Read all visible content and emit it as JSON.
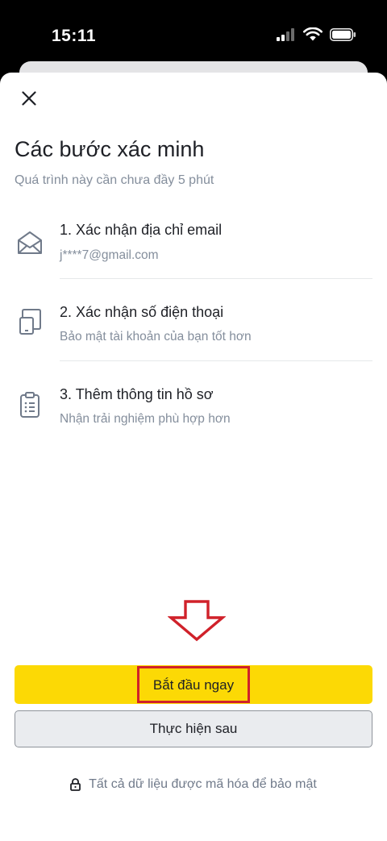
{
  "status_bar": {
    "time": "15:11",
    "icons": [
      "cellular-signal-icon",
      "wifi-icon",
      "battery-icon"
    ]
  },
  "header": {
    "close_icon": "close-icon",
    "title": "Các bước xác minh",
    "subtitle": "Quá trình này cần chưa đầy 5 phút"
  },
  "steps": [
    {
      "icon": "envelope-icon",
      "title": "1. Xác nhận địa chỉ email",
      "subtitle": "j****7@gmail.com"
    },
    {
      "icon": "phone-icon",
      "title": "2. Xác nhận số điện thoại",
      "subtitle": "Bảo mật tài khoản của bạn tốt hơn"
    },
    {
      "icon": "clipboard-icon",
      "title": "3. Thêm thông tin hồ sơ",
      "subtitle": "Nhận trải nghiệm phù hợp hơn"
    }
  ],
  "actions": {
    "primary_label": "Bắt đầu ngay",
    "secondary_label": "Thực hiện sau"
  },
  "footer": {
    "icon": "lock-icon",
    "text": "Tất cả dữ liệu được mã hóa để bảo mật"
  },
  "colors": {
    "primary_button": "#FCD905",
    "highlight_annotation": "#D0212A",
    "text_primary": "#1E2026",
    "text_secondary": "#848E9C"
  }
}
